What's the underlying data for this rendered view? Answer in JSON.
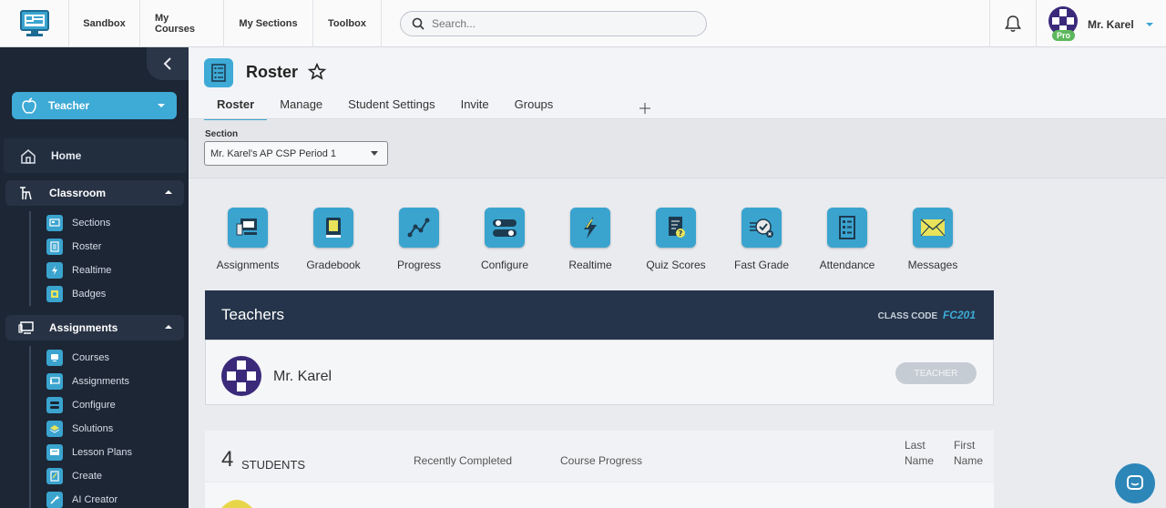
{
  "topbar": {
    "nav": [
      "Sandbox",
      "My Courses",
      "My Sections",
      "Toolbox"
    ],
    "search_placeholder": "Search...",
    "user_name": "Mr. Karel",
    "pro_badge": "Pro"
  },
  "sidebar": {
    "role": "Teacher",
    "home": "Home",
    "classroom": {
      "title": "Classroom",
      "items": [
        "Sections",
        "Roster",
        "Realtime",
        "Badges"
      ]
    },
    "assignments": {
      "title": "Assignments",
      "items": [
        "Courses",
        "Assignments",
        "Configure",
        "Solutions",
        "Lesson Plans",
        "Create",
        "AI Creator"
      ]
    }
  },
  "page": {
    "title": "Roster",
    "tabs": [
      "Roster",
      "Manage",
      "Student Settings",
      "Invite",
      "Groups"
    ],
    "active_tab": "Roster",
    "section_label": "Section",
    "section_value": "Mr. Karel's AP CSP Period 1"
  },
  "tools": [
    "Assignments",
    "Gradebook",
    "Progress",
    "Configure",
    "Realtime",
    "Quiz Scores",
    "Fast Grade",
    "Attendance",
    "Messages"
  ],
  "teachers": {
    "title": "Teachers",
    "class_code_label": "CLASS CODE",
    "class_code": "FC201",
    "teacher_name": "Mr. Karel",
    "teacher_badge": "TEACHER"
  },
  "students": {
    "count": "4",
    "label": "STUDENTS",
    "col_recent": "Recently Completed",
    "col_progress": "Course Progress",
    "col_last_1": "Last",
    "col_last_2": "Name",
    "col_first_1": "First",
    "col_first_2": "Name"
  },
  "colors": {
    "accent": "#3aa4cf",
    "sidebar_bg": "#1c2635",
    "teachers_header": "#25344a"
  }
}
